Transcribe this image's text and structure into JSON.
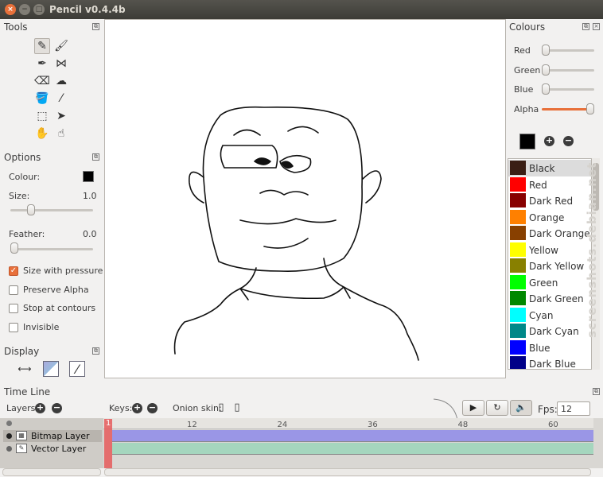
{
  "window": {
    "title": "Pencil v0.4.4b"
  },
  "tools": {
    "title": "Tools",
    "items": [
      {
        "name": "pencil",
        "glyph": "✎",
        "active": true
      },
      {
        "name": "brush",
        "glyph": "🖌",
        "active": false
      },
      {
        "name": "pen",
        "glyph": "✒",
        "active": false
      },
      {
        "name": "polyline",
        "glyph": "⋈",
        "active": false
      },
      {
        "name": "eraser",
        "glyph": "⌫",
        "active": false
      },
      {
        "name": "smudge",
        "glyph": "☁",
        "active": false
      },
      {
        "name": "bucket",
        "glyph": "🪣",
        "active": false
      },
      {
        "name": "eyedropper",
        "glyph": "⁄",
        "active": false
      },
      {
        "name": "select",
        "glyph": "⬚",
        "active": false
      },
      {
        "name": "move",
        "glyph": "➤",
        "active": false
      },
      {
        "name": "hand",
        "glyph": "✋",
        "active": false
      },
      {
        "name": "smudge-finger",
        "glyph": "☝",
        "active": false
      }
    ]
  },
  "options": {
    "title": "Options",
    "colour_label": "Colour:",
    "colour_value": "#000000",
    "size_label": "Size:",
    "size_value": "1.0",
    "size_fraction": 0.22,
    "feather_label": "Feather:",
    "feather_value": "0.0",
    "feather_fraction": 0.0,
    "checkboxes": [
      {
        "label": "Size with pressure",
        "checked": true
      },
      {
        "label": "Preserve Alpha",
        "checked": false
      },
      {
        "label": "Stop at contours",
        "checked": false
      },
      {
        "label": "Invisible",
        "checked": false
      }
    ]
  },
  "display": {
    "title": "Display"
  },
  "colours": {
    "title": "Colours",
    "sliders": [
      {
        "label": "Red",
        "fraction": 0.0
      },
      {
        "label": "Green",
        "fraction": 0.0
      },
      {
        "label": "Blue",
        "fraction": 0.0
      },
      {
        "label": "Alpha",
        "fraction": 1.0
      }
    ],
    "current": "#000000",
    "add_glyph": "+",
    "remove_glyph": "−",
    "palette": [
      {
        "name": "Black",
        "color": "#3a1e14",
        "selected": true
      },
      {
        "name": "Red",
        "color": "#ff0000",
        "selected": false
      },
      {
        "name": "Dark Red",
        "color": "#880000",
        "selected": false
      },
      {
        "name": "Orange",
        "color": "#ff8000",
        "selected": false
      },
      {
        "name": "Dark Orange",
        "color": "#884000",
        "selected": false
      },
      {
        "name": "Yellow",
        "color": "#ffff00",
        "selected": false
      },
      {
        "name": "Dark Yellow",
        "color": "#888000",
        "selected": false
      },
      {
        "name": "Green",
        "color": "#00ff00",
        "selected": false
      },
      {
        "name": "Dark Green",
        "color": "#008800",
        "selected": false
      },
      {
        "name": "Cyan",
        "color": "#00ffff",
        "selected": false
      },
      {
        "name": "Dark Cyan",
        "color": "#008888",
        "selected": false
      },
      {
        "name": "Blue",
        "color": "#0000ff",
        "selected": false
      },
      {
        "name": "Dark Blue",
        "color": "#000088",
        "selected": false
      }
    ]
  },
  "timeline": {
    "title": "Time Line",
    "layers_label": "Layers:",
    "keys_label": "Keys:",
    "onion_label": "Onion skin:",
    "fps_label": "Fps:",
    "fps_value": "12",
    "play_glyph": "▶",
    "loop_glyph": "↻",
    "sound_glyph": "🔈",
    "current_frame": "1",
    "ruler": [
      "12",
      "24",
      "36",
      "48",
      "60"
    ],
    "layers": [
      {
        "name": "Bitmap Layer",
        "color": "#9a96e6"
      },
      {
        "name": "Vector Layer",
        "color": "#a5d6be"
      }
    ]
  },
  "watermark": "screenshots.debian.net"
}
